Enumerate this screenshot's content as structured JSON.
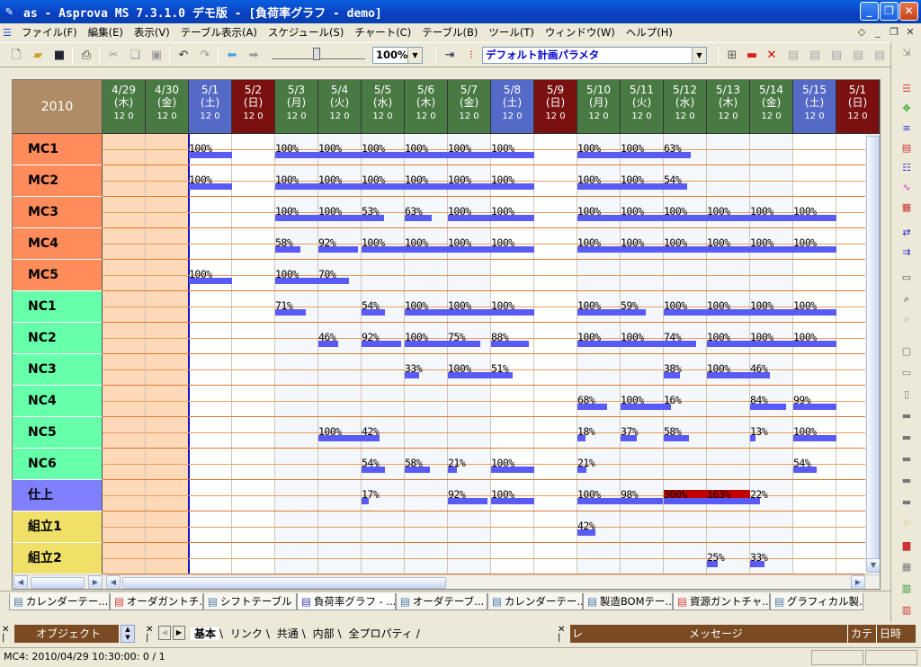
{
  "window": {
    "title": "as - Asprova MS 7.3.1.0 デモ版 - [負荷率グラフ - demo]"
  },
  "menu": [
    "ファイル(F)",
    "編集(E)",
    "表示(V)",
    "テーブル表示(A)",
    "スケジュール(S)",
    "チャート(C)",
    "テーブル(B)",
    "ツール(T)",
    "ウィンドウ(W)",
    "ヘルプ(H)"
  ],
  "toolbar": {
    "zoom": "100%",
    "param_combo": "デフォルト計画パラメタ"
  },
  "chart": {
    "year": "2010",
    "hour_labels": "12  0",
    "days": [
      {
        "date": "4/29",
        "wd": "(木)",
        "kind": "past"
      },
      {
        "date": "4/30",
        "wd": "(金)",
        "kind": "past"
      },
      {
        "date": "5/1",
        "wd": "(土)",
        "kind": "sat"
      },
      {
        "date": "5/2",
        "wd": "(日)",
        "kind": "sun"
      },
      {
        "date": "5/3",
        "wd": "(月)",
        "kind": "work"
      },
      {
        "date": "5/4",
        "wd": "(火)",
        "kind": "work"
      },
      {
        "date": "5/5",
        "wd": "(水)",
        "kind": "work"
      },
      {
        "date": "5/6",
        "wd": "(木)",
        "kind": "work"
      },
      {
        "date": "5/7",
        "wd": "(金)",
        "kind": "work"
      },
      {
        "date": "5/8",
        "wd": "(土)",
        "kind": "sat"
      },
      {
        "date": "5/9",
        "wd": "(日)",
        "kind": "sun"
      },
      {
        "date": "5/10",
        "wd": "(月)",
        "kind": "work"
      },
      {
        "date": "5/11",
        "wd": "(火)",
        "kind": "work"
      },
      {
        "date": "5/12",
        "wd": "(水)",
        "kind": "work"
      },
      {
        "date": "5/13",
        "wd": "(木)",
        "kind": "work"
      },
      {
        "date": "5/14",
        "wd": "(金)",
        "kind": "work"
      },
      {
        "date": "5/15",
        "wd": "(土)",
        "kind": "sat"
      },
      {
        "date": "5/1",
        "wd": "(日)",
        "kind": "sun"
      }
    ],
    "resources": [
      {
        "name": "MC1",
        "color": "#ff8c5a",
        "loads": [
          [
            2,
            "100%"
          ],
          [
            4,
            "100%"
          ],
          [
            5,
            "100%"
          ],
          [
            6,
            "100%"
          ],
          [
            7,
            "100%"
          ],
          [
            8,
            "100%"
          ],
          [
            9,
            "100%"
          ],
          [
            11,
            "100%"
          ],
          [
            12,
            "100%"
          ],
          [
            13,
            "63%"
          ]
        ]
      },
      {
        "name": "MC2",
        "color": "#ff8c5a",
        "loads": [
          [
            2,
            "100%"
          ],
          [
            4,
            "100%"
          ],
          [
            5,
            "100%"
          ],
          [
            6,
            "100%"
          ],
          [
            7,
            "100%"
          ],
          [
            8,
            "100%"
          ],
          [
            9,
            "100%"
          ],
          [
            11,
            "100%"
          ],
          [
            12,
            "100%"
          ],
          [
            13,
            "54%"
          ]
        ]
      },
      {
        "name": "MC3",
        "color": "#ff8c5a",
        "loads": [
          [
            4,
            "100%"
          ],
          [
            5,
            "100%"
          ],
          [
            6,
            "53%"
          ],
          [
            7,
            "63%"
          ],
          [
            8,
            "100%"
          ],
          [
            9,
            "100%"
          ],
          [
            11,
            "100%"
          ],
          [
            12,
            "100%"
          ],
          [
            13,
            "100%"
          ],
          [
            14,
            "100%"
          ],
          [
            15,
            "100%"
          ],
          [
            16,
            "100%"
          ]
        ]
      },
      {
        "name": "MC4",
        "color": "#ff8c5a",
        "loads": [
          [
            4,
            "58%"
          ],
          [
            5,
            "92%"
          ],
          [
            6,
            "100%"
          ],
          [
            7,
            "100%"
          ],
          [
            8,
            "100%"
          ],
          [
            9,
            "100%"
          ],
          [
            11,
            "100%"
          ],
          [
            12,
            "100%"
          ],
          [
            13,
            "100%"
          ],
          [
            14,
            "100%"
          ],
          [
            15,
            "100%"
          ],
          [
            16,
            "100%"
          ]
        ]
      },
      {
        "name": "MC5",
        "color": "#ff8c5a",
        "loads": [
          [
            2,
            "100%"
          ],
          [
            4,
            "100%"
          ],
          [
            5,
            "70%"
          ]
        ]
      },
      {
        "name": "NC1",
        "color": "#66ffaa",
        "loads": [
          [
            4,
            "71%"
          ],
          [
            6,
            "54%"
          ],
          [
            7,
            "100%"
          ],
          [
            8,
            "100%"
          ],
          [
            9,
            "100%"
          ],
          [
            11,
            "100%"
          ],
          [
            12,
            "59%"
          ],
          [
            13,
            "100%"
          ],
          [
            14,
            "100%"
          ],
          [
            15,
            "100%"
          ],
          [
            16,
            "100%"
          ]
        ]
      },
      {
        "name": "NC2",
        "color": "#66ffaa",
        "loads": [
          [
            5,
            "46%"
          ],
          [
            6,
            "92%"
          ],
          [
            7,
            "100%"
          ],
          [
            8,
            "75%"
          ],
          [
            9,
            "88%"
          ],
          [
            11,
            "100%"
          ],
          [
            12,
            "100%"
          ],
          [
            13,
            "74%"
          ],
          [
            14,
            "100%"
          ],
          [
            15,
            "100%"
          ],
          [
            16,
            "100%"
          ]
        ]
      },
      {
        "name": "NC3",
        "color": "#66ffaa",
        "loads": [
          [
            7,
            "33%"
          ],
          [
            8,
            "100%"
          ],
          [
            9,
            "51%"
          ],
          [
            13,
            "38%"
          ],
          [
            14,
            "100%"
          ],
          [
            15,
            "46%"
          ]
        ]
      },
      {
        "name": "NC4",
        "color": "#66ffaa",
        "loads": [
          [
            11,
            "68%"
          ],
          [
            12,
            "100%"
          ],
          [
            13,
            "16%"
          ],
          [
            15,
            "84%"
          ],
          [
            16,
            "99%"
          ]
        ]
      },
      {
        "name": "NC5",
        "color": "#66ffaa",
        "loads": [
          [
            5,
            "100%"
          ],
          [
            6,
            "42%"
          ],
          [
            11,
            "18%"
          ],
          [
            12,
            "37%"
          ],
          [
            13,
            "58%"
          ],
          [
            15,
            "13%"
          ],
          [
            16,
            "100%"
          ]
        ]
      },
      {
        "name": "NC6",
        "color": "#66ffaa",
        "loads": [
          [
            6,
            "54%"
          ],
          [
            7,
            "58%"
          ],
          [
            8,
            "21%"
          ],
          [
            9,
            "100%"
          ],
          [
            11,
            "21%"
          ],
          [
            16,
            "54%"
          ]
        ]
      },
      {
        "name": "仕上",
        "color": "#8080ff",
        "loads": [
          [
            6,
            "17%"
          ],
          [
            8,
            "92%"
          ],
          [
            9,
            "100%"
          ],
          [
            11,
            "100%"
          ],
          [
            12,
            "98%"
          ],
          [
            13,
            "300%"
          ],
          [
            14,
            "163%"
          ],
          [
            15,
            "22%"
          ]
        ]
      },
      {
        "name": "組立1",
        "color": "#f0e068",
        "loads": [
          [
            11,
            "42%"
          ]
        ]
      },
      {
        "name": "組立2",
        "color": "#f0e068",
        "loads": [
          [
            14,
            "25%"
          ],
          [
            15,
            "33%"
          ]
        ]
      }
    ]
  },
  "tabs": [
    "カレンダーテー...",
    "オーダガントチ...",
    "シフトテーブル ...",
    "負荷率グラフ - ...",
    "オーダテーブ...",
    "カレンダーテー...",
    "製造BOMテー...",
    "資源ガントチャ...",
    "グラフィカル製..."
  ],
  "bottom": {
    "object_label": "オブジェクト",
    "prop_tabs": [
      "基本",
      "リンク",
      "共通",
      "内部",
      "全プロパティ"
    ],
    "message_header": "メッセージ",
    "level_header": "レ",
    "category_header": "カテ",
    "time_header": "日時"
  },
  "status": {
    "text": "MC4: 2010/04/29 10:30:00: 0 / 1"
  }
}
